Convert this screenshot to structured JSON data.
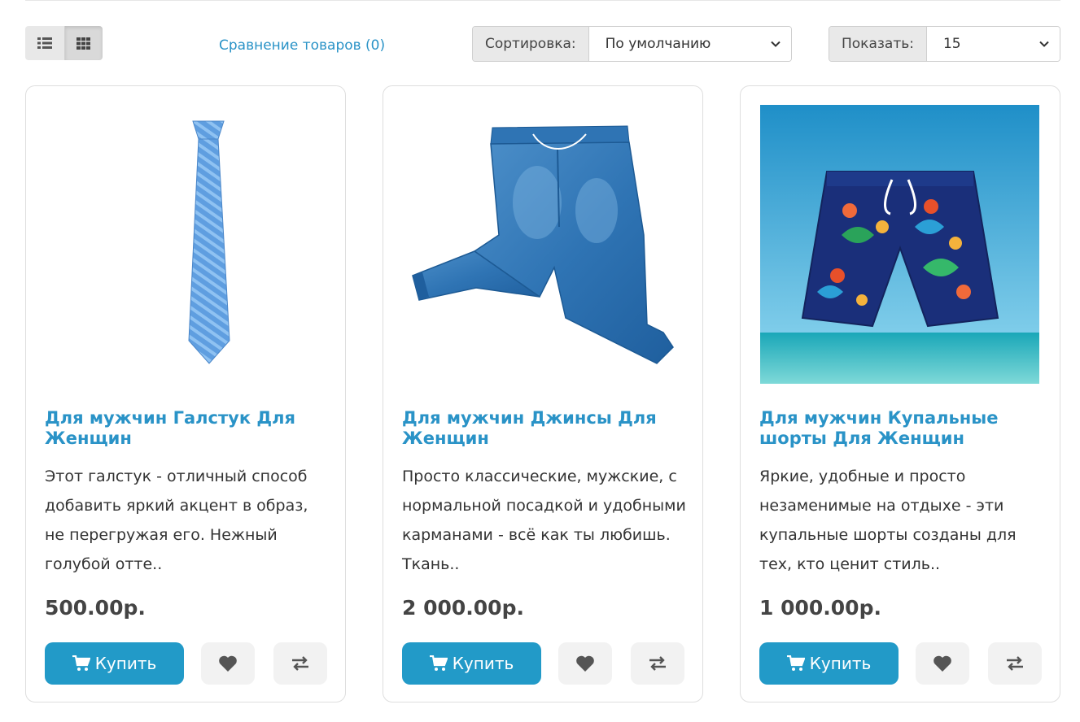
{
  "toolbar": {
    "compare_label": "Сравнение товаров (0)",
    "sort_label": "Сортировка:",
    "sort_value": "По умолчанию",
    "limit_label": "Показать:",
    "limit_value": "15"
  },
  "colors": {
    "accent": "#229ac8",
    "link": "#2a93c7",
    "price": "#444444"
  },
  "products": [
    {
      "title": "Для мужчин Галстук Для Женщин",
      "description": "Этот галстук - отличный способ добавить яркий акцент в образ, не перегружая его. Нежный голубой отте..",
      "price": "500.00р.",
      "buy_label": "Купить",
      "image": "blue-tie-image"
    },
    {
      "title": "Для мужчин Джинсы Для Женщин",
      "description": "Просто классические, мужские, с нормальной посадкой и удобными карманами - всё как ты любишь. Ткань..",
      "price": "2 000.00р.",
      "buy_label": "Купить",
      "image": "denim-jeans-image"
    },
    {
      "title": "Для мужчин Купальные шорты Для Женщин",
      "description": "Яркие, удобные и просто незаменимые на отдыхе - эти купальные шорты созданы для тех, кто ценит стиль..",
      "price": "1 000.00р.",
      "buy_label": "Купить",
      "image": "swim-shorts-image"
    }
  ]
}
